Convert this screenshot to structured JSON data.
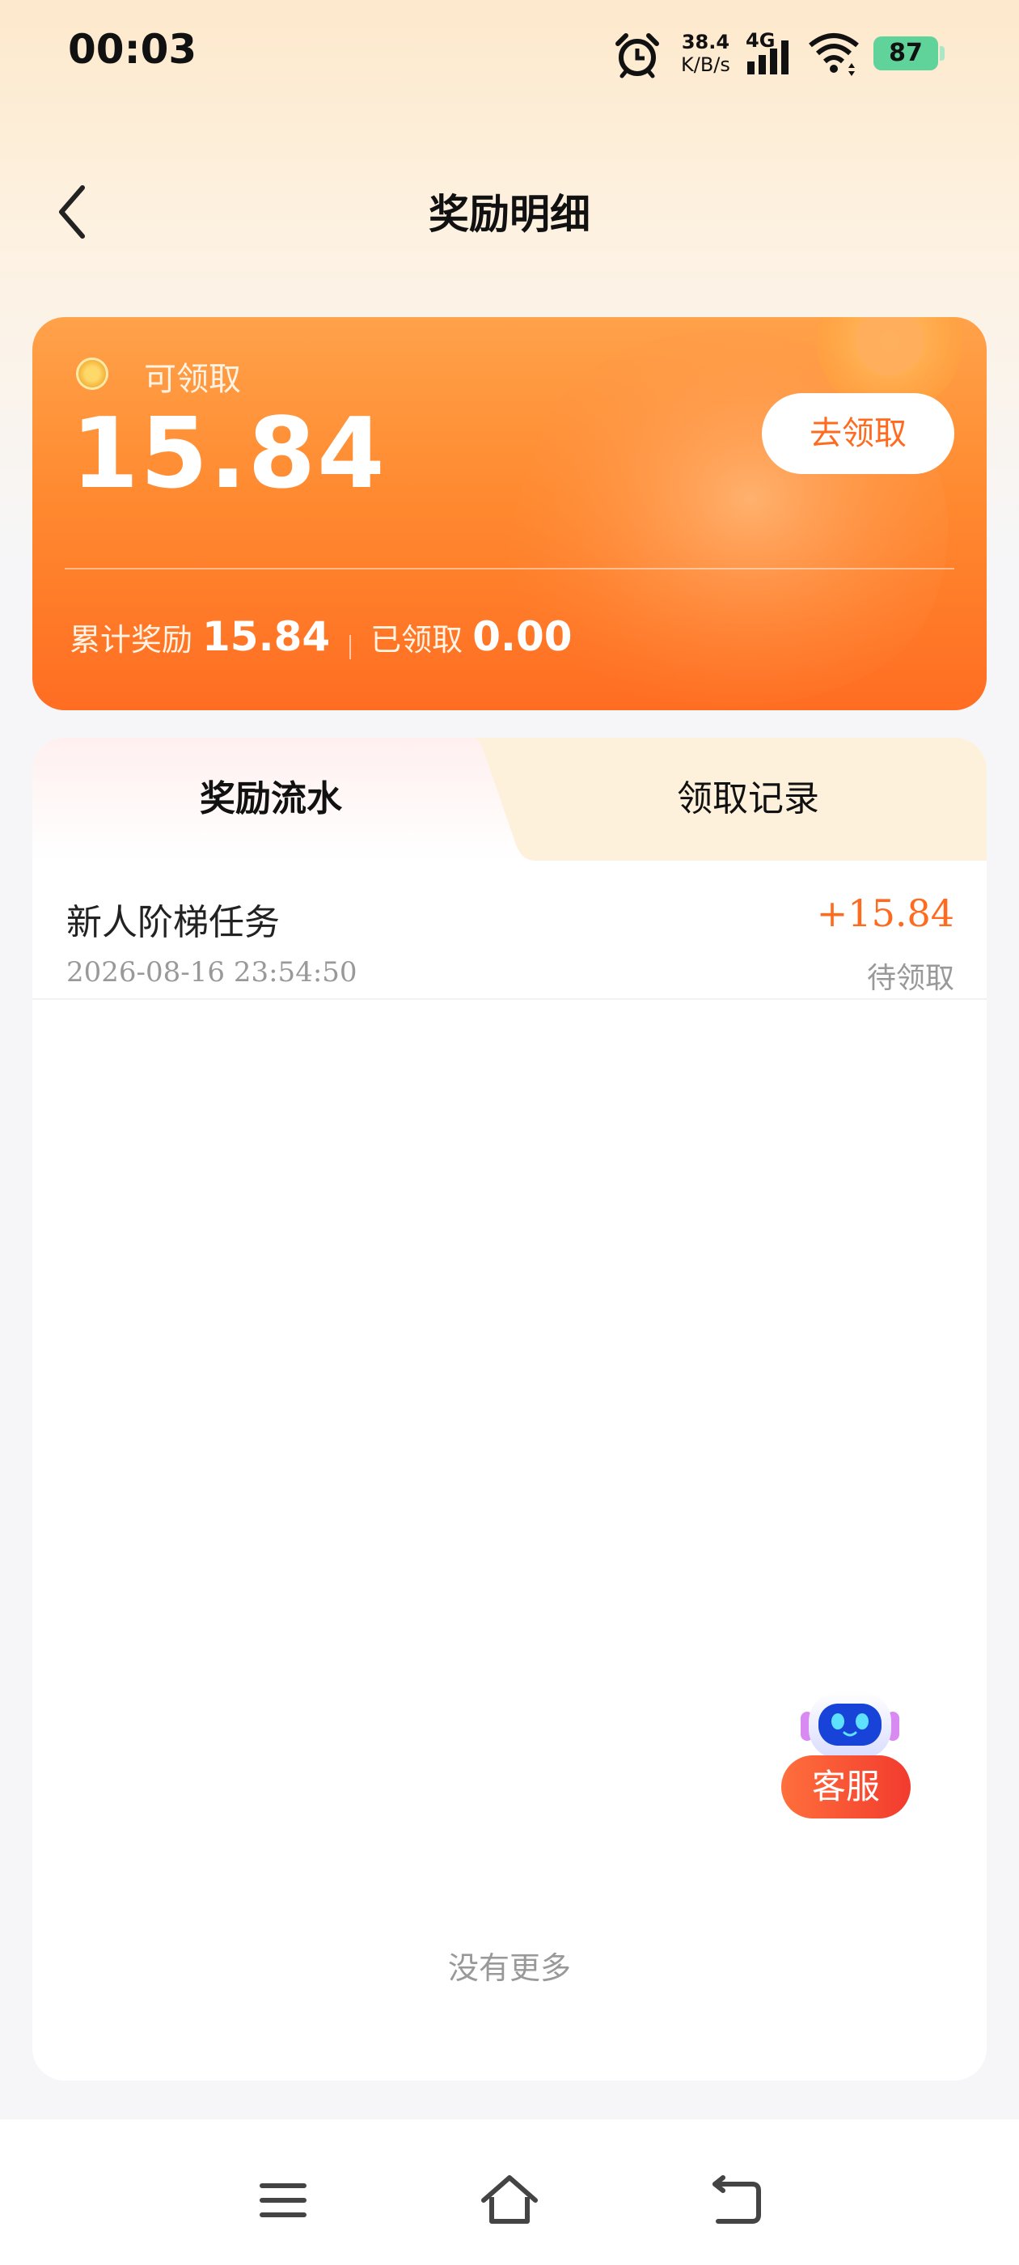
{
  "status_bar": {
    "time": "00:03",
    "net_speed_value": "38.4",
    "net_speed_unit": "K/B/s",
    "network_type": "4G",
    "battery": "87",
    "icons": [
      "alarm-icon",
      "signal-icon",
      "wifi-icon",
      "battery-icon"
    ]
  },
  "header": {
    "title": "奖励明细",
    "back_icon": "chevron-left-icon"
  },
  "reward_card": {
    "claimable_label": "可领取",
    "claimable_amount": "15.84",
    "claim_button": "去领取",
    "total_label": "累计奖励",
    "total_value": "15.84",
    "claimed_label": "已领取",
    "claimed_value": "0.00",
    "colors": {
      "card_top": "#ffa24a",
      "card_bottom": "#ff6d22",
      "accent": "#ff6a1e"
    }
  },
  "tabs": [
    {
      "label": "奖励流水",
      "active": true
    },
    {
      "label": "领取记录",
      "active": false
    }
  ],
  "records": [
    {
      "title": "新人阶梯任务",
      "amount": "+15.84",
      "time": "2026-08-16 23:54:50",
      "status": "待领取"
    }
  ],
  "list_footer": "没有更多",
  "customer_service": {
    "label": "客服",
    "icon": "robot-icon"
  },
  "nav_bar": {
    "icons": [
      "menu-icon",
      "home-icon",
      "back-icon"
    ]
  }
}
